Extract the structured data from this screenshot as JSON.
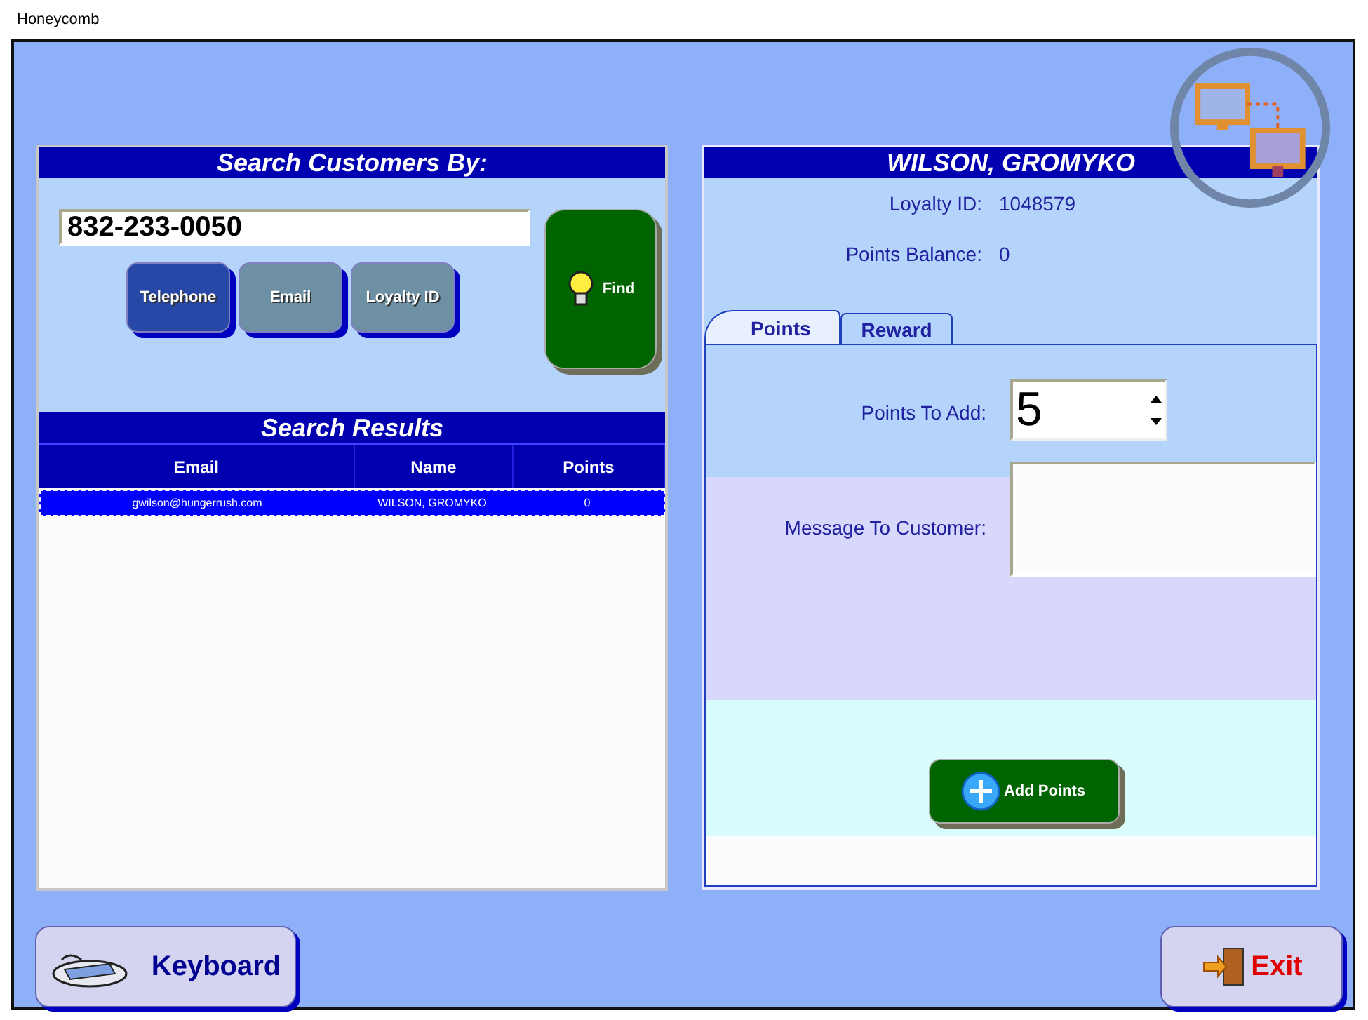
{
  "window": {
    "title": "Honeycomb"
  },
  "search": {
    "title": "Search Customers By:",
    "value": "832-233-0050",
    "find_button": "Find",
    "search_types": [
      {
        "label": "Telephone",
        "selected": true
      },
      {
        "label": "Email",
        "selected": false
      },
      {
        "label": "Loyalty ID",
        "selected": false
      }
    ]
  },
  "results": {
    "title": "Search Results",
    "columns": [
      "Email",
      "Name",
      "Points"
    ],
    "rows": [
      {
        "cells": [
          "gwilson@hungerrush.com",
          "WILSON, GROMYKO",
          "0"
        ],
        "selected": true
      }
    ]
  },
  "customer": {
    "name": "WILSON, GROMYKO",
    "fields": [
      {
        "label": "Loyalty ID:",
        "value": "1048579"
      },
      {
        "label": "Points Balance:",
        "value": "0"
      }
    ],
    "tabs": [
      {
        "label": "Points",
        "selected": true
      },
      {
        "label": "Reward",
        "selected": false
      }
    ],
    "points_to_add": {
      "label": "Points To Add:",
      "value": "5"
    },
    "message": {
      "label": "Message To Customer:"
    },
    "add_button": "Add Points"
  },
  "buttons": {
    "keyboard": "Keyboard",
    "exit": "Exit"
  }
}
